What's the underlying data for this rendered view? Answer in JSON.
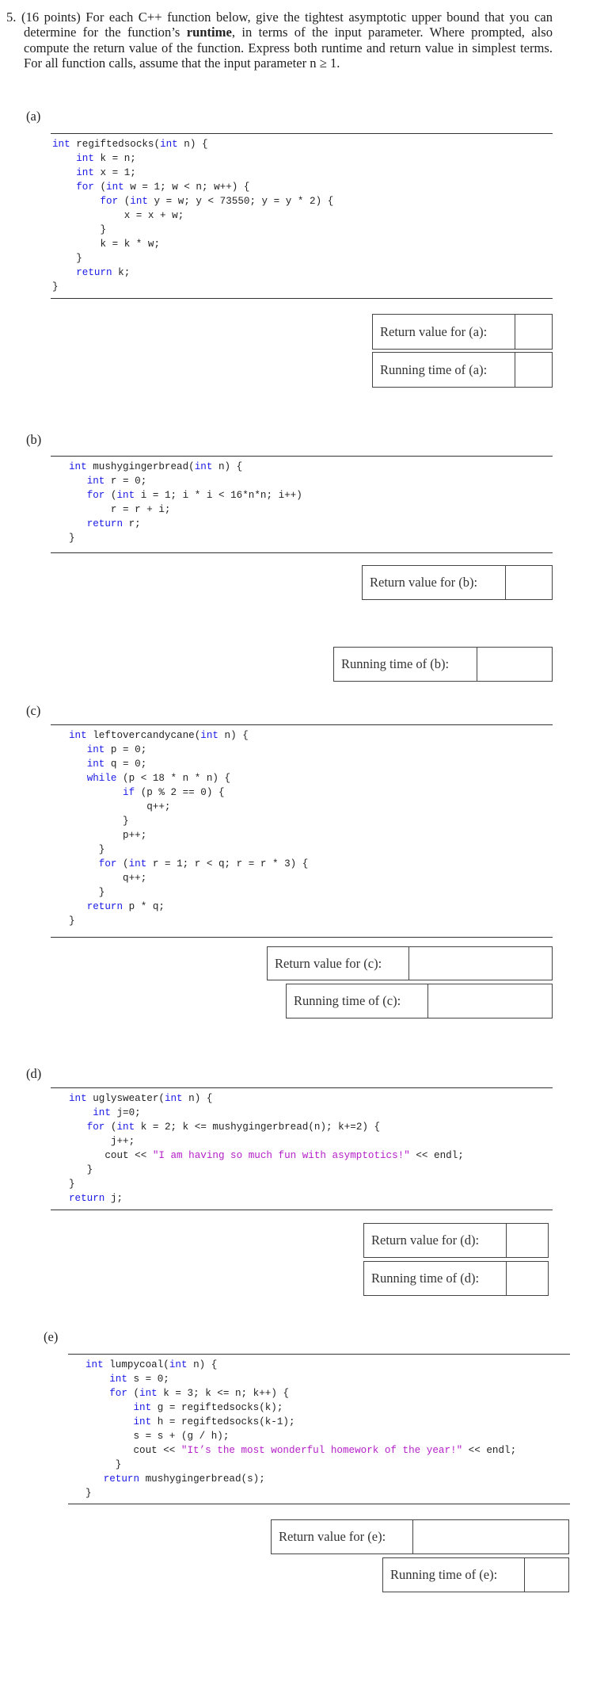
{
  "question": {
    "number": "5.",
    "points": "(16 points)",
    "text_before_bold": "For each C++ function below, give the tightest asymptotic upper bound that you can determine for the function’s ",
    "bold": "runtime",
    "text_after_bold": ", in terms of the input parameter. Where prompted, also compute the return value of the function. Express both runtime and return value in simplest terms.  For all function calls, assume that the input parameter n ≥ 1."
  },
  "parts": [
    {
      "label": "(a)",
      "code": [
        [
          [
            "kw",
            "int"
          ],
          [
            "t",
            " regiftedsocks("
          ],
          [
            "kw",
            "int"
          ],
          [
            "t",
            " n) {"
          ]
        ],
        [
          [
            "t",
            "    "
          ],
          [
            "kw",
            "int"
          ],
          [
            "t",
            " k = n;"
          ]
        ],
        [
          [
            "t",
            "    "
          ],
          [
            "kw",
            "int"
          ],
          [
            "t",
            " x = 1;"
          ]
        ],
        [
          [
            "t",
            "    "
          ],
          [
            "kw",
            "for"
          ],
          [
            "t",
            " ("
          ],
          [
            "kw",
            "int"
          ],
          [
            "t",
            " w = 1; w < n; w++) {"
          ]
        ],
        [
          [
            "t",
            "        "
          ],
          [
            "kw",
            "for"
          ],
          [
            "t",
            " ("
          ],
          [
            "kw",
            "int"
          ],
          [
            "t",
            " y = w; y < 73550; y = y * 2) {"
          ]
        ],
        [
          [
            "t",
            "            x = x + w;"
          ]
        ],
        [
          [
            "t",
            "        }"
          ]
        ],
        [
          [
            "t",
            "        k = k * w;"
          ]
        ],
        [
          [
            "t",
            "    }"
          ]
        ],
        [
          [
            "t",
            "    "
          ],
          [
            "kw",
            "return"
          ],
          [
            "t",
            " k;"
          ]
        ],
        [
          [
            "t",
            "}"
          ]
        ]
      ],
      "return_label": "Return value for (a):",
      "return_value": "",
      "runtime_label": "Running time of (a):",
      "runtime_value": ""
    },
    {
      "label": "(b)",
      "code": [
        [
          [
            "kw",
            "int"
          ],
          [
            "t",
            " mushygingerbread("
          ],
          [
            "kw",
            "int"
          ],
          [
            "t",
            " n) {"
          ]
        ],
        [
          [
            "t",
            "   "
          ],
          [
            "kw",
            "int"
          ],
          [
            "t",
            " r = 0;"
          ]
        ],
        [
          [
            "t",
            "   "
          ],
          [
            "kw",
            "for"
          ],
          [
            "t",
            " ("
          ],
          [
            "kw",
            "int"
          ],
          [
            "t",
            " i = 1; i * i < 16*n*n; i++)"
          ]
        ],
        [
          [
            "t",
            "       r = r + i;"
          ]
        ],
        [
          [
            "t",
            "   "
          ],
          [
            "kw",
            "return"
          ],
          [
            "t",
            " r;"
          ]
        ],
        [
          [
            "t",
            "}"
          ]
        ]
      ],
      "return_label": "Return value for (b):",
      "return_value": "",
      "runtime_label": "Running time of (b):",
      "runtime_value": ""
    },
    {
      "label": "(c)",
      "code": [
        [
          [
            "kw",
            "int"
          ],
          [
            "t",
            " leftovercandycane("
          ],
          [
            "kw",
            "int"
          ],
          [
            "t",
            " n) {"
          ]
        ],
        [
          [
            "t",
            "   "
          ],
          [
            "kw",
            "int"
          ],
          [
            "t",
            " p = 0;"
          ]
        ],
        [
          [
            "t",
            "   "
          ],
          [
            "kw",
            "int"
          ],
          [
            "t",
            " q = 0;"
          ]
        ],
        [
          [
            "t",
            "   "
          ],
          [
            "kw",
            "while"
          ],
          [
            "t",
            " (p < 18 * n * n) {"
          ]
        ],
        [
          [
            "t",
            "         "
          ],
          [
            "kw",
            "if"
          ],
          [
            "t",
            " (p % 2 == 0) {"
          ]
        ],
        [
          [
            "t",
            "             q++;"
          ]
        ],
        [
          [
            "t",
            "         }"
          ]
        ],
        [
          [
            "t",
            "         p++;"
          ]
        ],
        [
          [
            "t",
            "     }"
          ]
        ],
        [
          [
            "t",
            "     "
          ],
          [
            "kw",
            "for"
          ],
          [
            "t",
            " ("
          ],
          [
            "kw",
            "int"
          ],
          [
            "t",
            " r = 1; r < q; r = r * 3) {"
          ]
        ],
        [
          [
            "t",
            "         q++;"
          ]
        ],
        [
          [
            "t",
            "     }"
          ]
        ],
        [
          [
            "t",
            "   "
          ],
          [
            "kw",
            "return"
          ],
          [
            "t",
            " p * q;"
          ]
        ],
        [
          [
            "t",
            "}"
          ]
        ]
      ],
      "return_label": "Return value for (c):",
      "return_value": "",
      "runtime_label": "Running time of (c):",
      "runtime_value": ""
    },
    {
      "label": "(d)",
      "code": [
        [
          [
            "kw",
            "int"
          ],
          [
            "t",
            " uglysweater("
          ],
          [
            "kw",
            "int"
          ],
          [
            "t",
            " n) {"
          ]
        ],
        [
          [
            "t",
            "    "
          ],
          [
            "kw",
            "int"
          ],
          [
            "t",
            " j=0;"
          ]
        ],
        [
          [
            "t",
            "   "
          ],
          [
            "kw",
            "for"
          ],
          [
            "t",
            " ("
          ],
          [
            "kw",
            "int"
          ],
          [
            "t",
            " k = 2; k <= mushygingerbread(n); k+=2) {"
          ]
        ],
        [
          [
            "t",
            "       j++;"
          ]
        ],
        [
          [
            "t",
            "      cout << "
          ],
          [
            "str",
            "\"I am having so much fun with asymptotics!\""
          ],
          [
            "t",
            " << endl;"
          ]
        ],
        [
          [
            "t",
            "   }"
          ]
        ],
        [
          [
            "t",
            "}"
          ]
        ],
        [
          [
            "kw",
            "return"
          ],
          [
            "t",
            " j;"
          ]
        ]
      ],
      "return_label": "Return value for (d):",
      "return_value": "",
      "runtime_label": "Running time of (d):",
      "runtime_value": ""
    },
    {
      "label": "(e)",
      "code": [
        [
          [
            "kw",
            "int"
          ],
          [
            "t",
            " lumpycoal("
          ],
          [
            "kw",
            "int"
          ],
          [
            "t",
            " n) {"
          ]
        ],
        [
          [
            "t",
            "    "
          ],
          [
            "kw",
            "int"
          ],
          [
            "t",
            " s = 0;"
          ]
        ],
        [
          [
            "t",
            "    "
          ],
          [
            "kw",
            "for"
          ],
          [
            "t",
            " ("
          ],
          [
            "kw",
            "int"
          ],
          [
            "t",
            " k = 3; k <= n; k++) {"
          ]
        ],
        [
          [
            "t",
            "        "
          ],
          [
            "kw",
            "int"
          ],
          [
            "t",
            " g = regiftedsocks(k);"
          ]
        ],
        [
          [
            "t",
            "        "
          ],
          [
            "kw",
            "int"
          ],
          [
            "t",
            " h = regiftedsocks(k-1);"
          ]
        ],
        [
          [
            "t",
            "        s = s + (g / h);"
          ]
        ],
        [
          [
            "t",
            "        cout << "
          ],
          [
            "str",
            "\"It’s the most wonderful homework of the year!\""
          ],
          [
            "t",
            " << endl;"
          ]
        ],
        [
          [
            "t",
            "     }"
          ]
        ],
        [
          [
            "t",
            "   "
          ],
          [
            "kw",
            "return"
          ],
          [
            "t",
            " mushygingerbread(s);"
          ]
        ],
        [
          [
            "t",
            "}"
          ]
        ]
      ],
      "return_label": "Return value for (e):",
      "return_value": "",
      "runtime_label": "Running time of (e):",
      "runtime_value": ""
    }
  ],
  "colors": {
    "keyword": "#1a1ae6",
    "string": "#b41ec8",
    "text": "#222222"
  }
}
